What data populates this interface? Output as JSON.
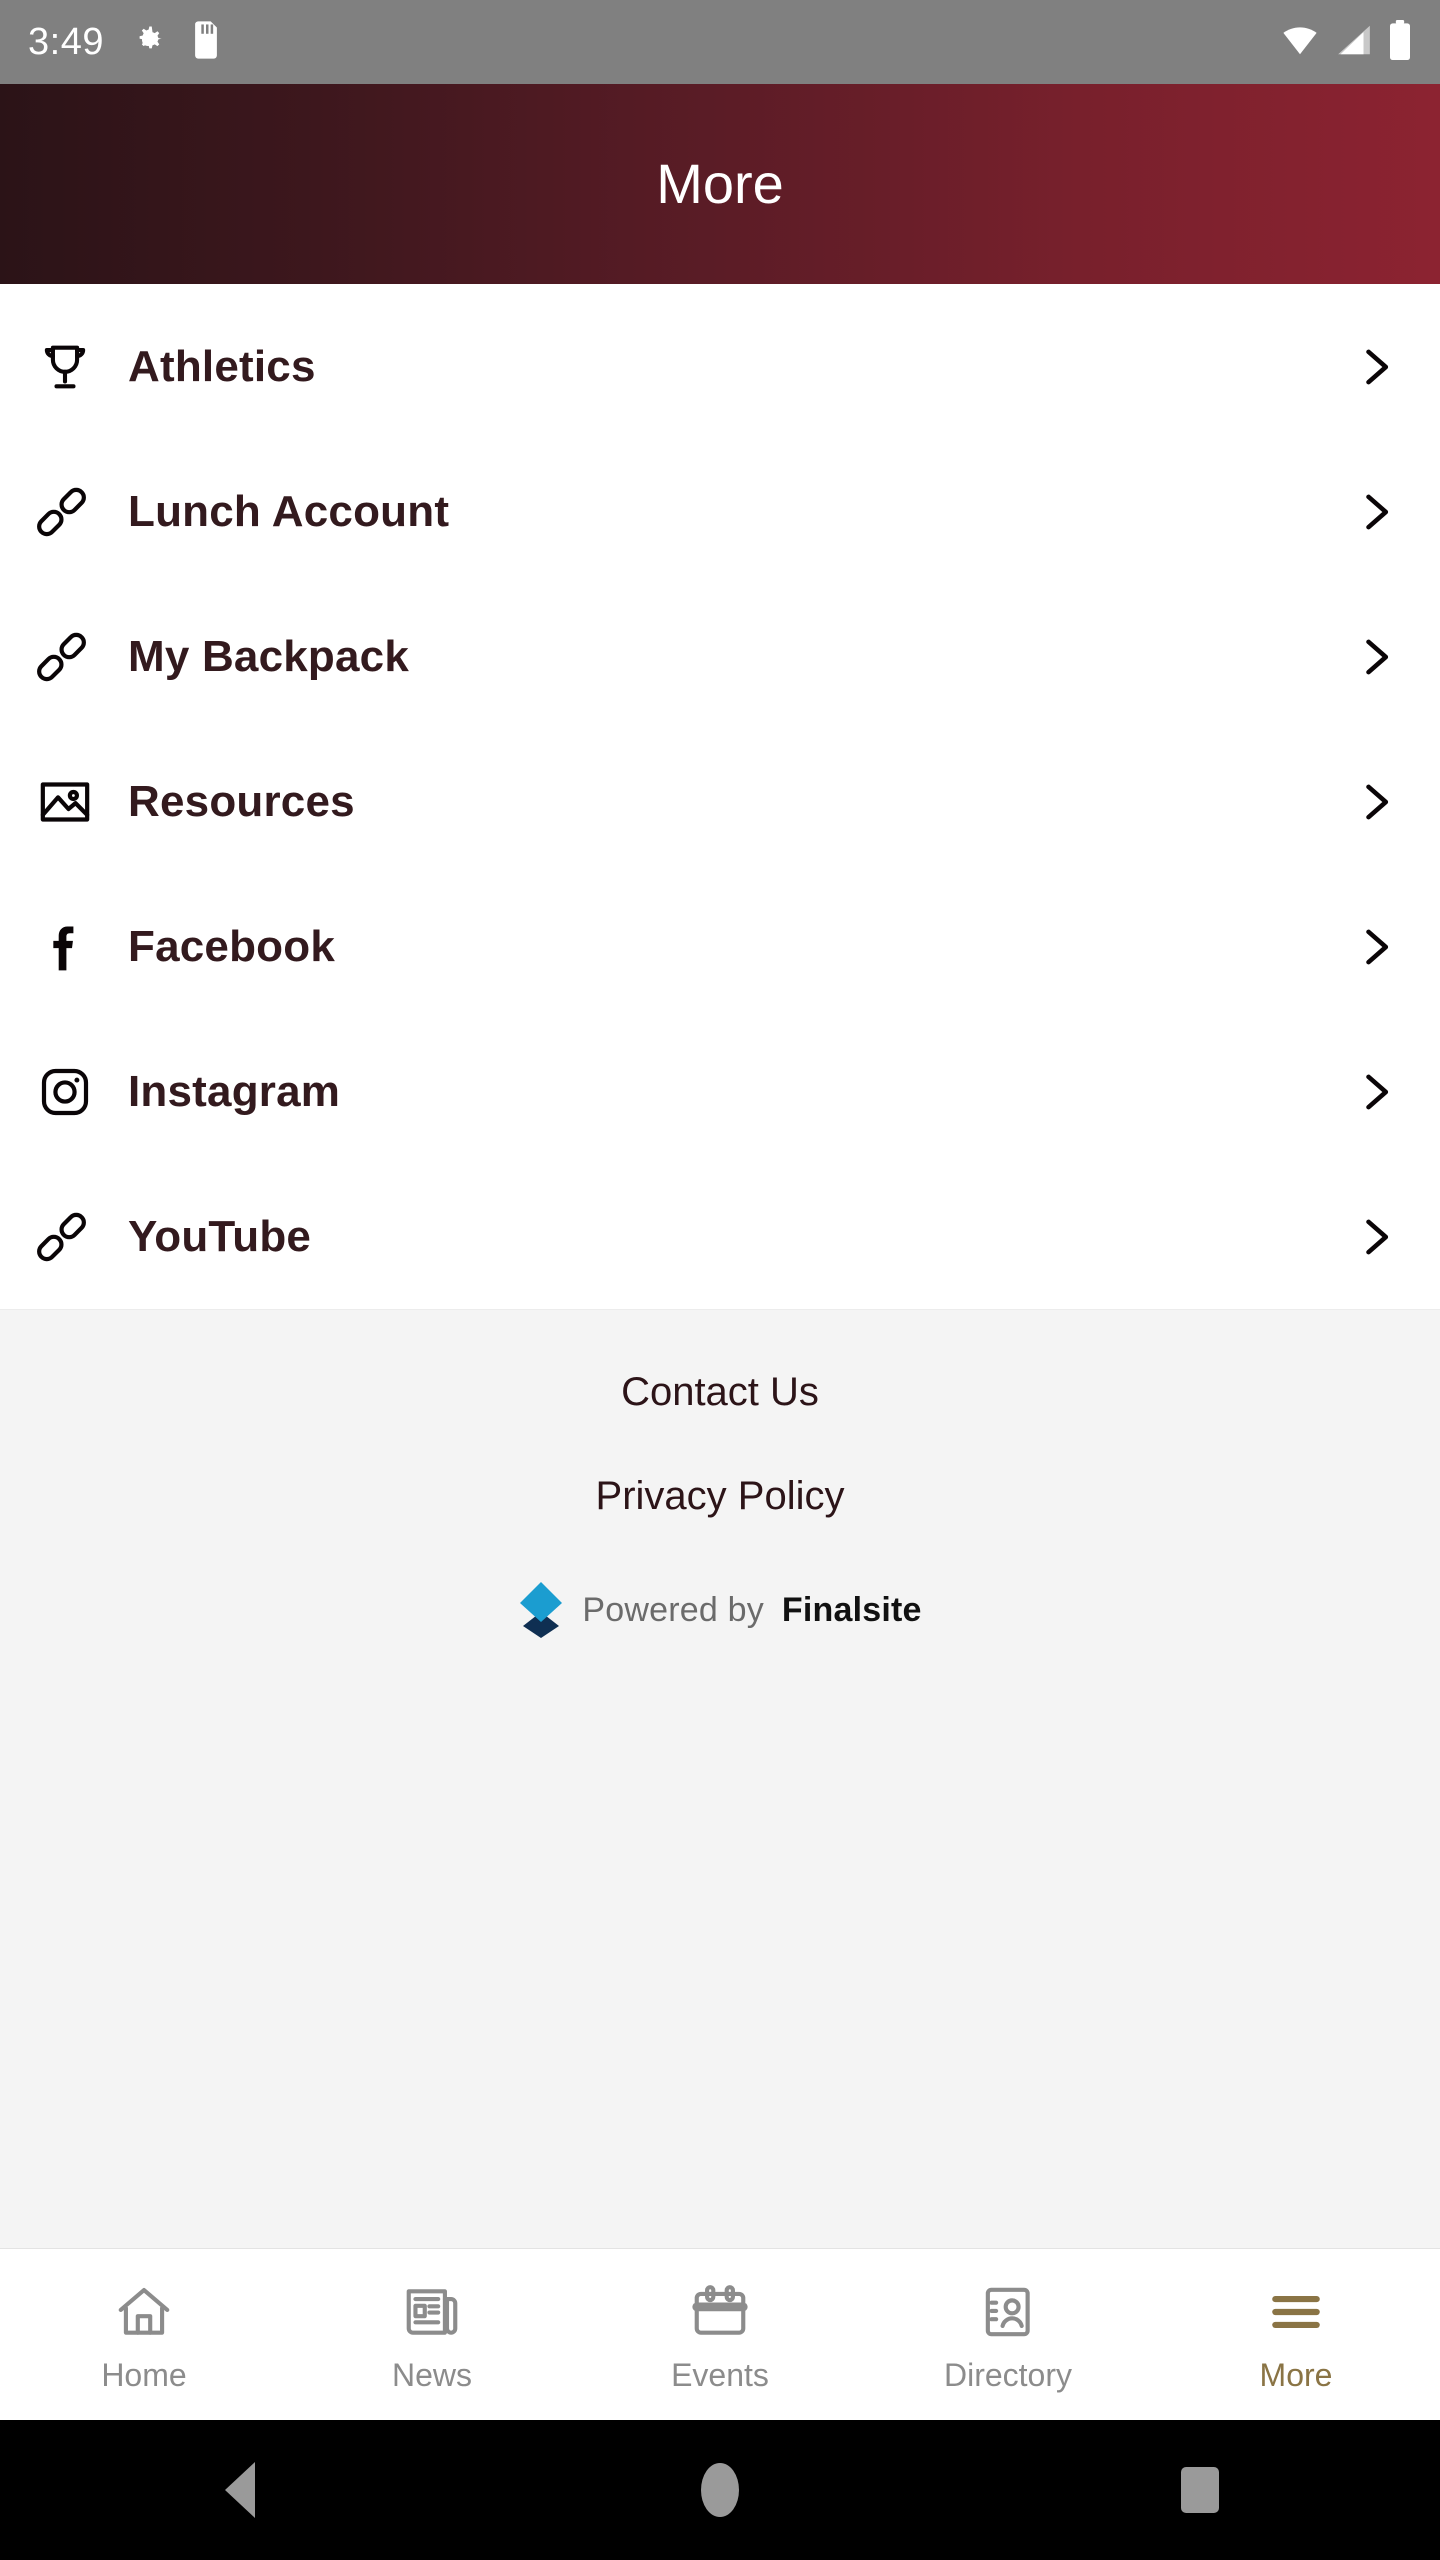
{
  "status_bar": {
    "time": "3:49",
    "left_icons": [
      "gear-icon",
      "sd-card-icon"
    ],
    "right_icons": [
      "wifi-icon",
      "cellular-signal-icon",
      "battery-icon"
    ],
    "background_color": "#808080"
  },
  "header": {
    "title": "More",
    "gradient_from": "#2b1317",
    "gradient_to": "#8c2331",
    "text_color": "#ffffff"
  },
  "menu": {
    "items": [
      {
        "label": "Athletics",
        "icon": "trophy-icon",
        "chevron": "chevron-right-icon"
      },
      {
        "label": "Lunch Account",
        "icon": "link-icon",
        "chevron": "chevron-right-icon"
      },
      {
        "label": "My Backpack",
        "icon": "link-icon",
        "chevron": "chevron-right-icon"
      },
      {
        "label": "Resources",
        "icon": "image-icon",
        "chevron": "chevron-right-icon"
      },
      {
        "label": "Facebook",
        "icon": "facebook-icon",
        "chevron": "chevron-right-icon"
      },
      {
        "label": "Instagram",
        "icon": "instagram-icon",
        "chevron": "chevron-right-icon"
      },
      {
        "label": "YouTube",
        "icon": "link-icon",
        "chevron": "chevron-right-icon"
      }
    ],
    "label_color": "#331a1e"
  },
  "footer": {
    "contact_label": "Contact Us",
    "privacy_label": "Privacy Policy",
    "powered_prefix": "Powered by",
    "powered_brand": "Finalsite",
    "logo_icon": "finalsite-diamond-logo",
    "logo_top_color": "#1b9dd0",
    "logo_bottom_color": "#0f2f52",
    "background_color": "#f4f4f4"
  },
  "tab_bar": {
    "active_color": "#8a7445",
    "inactive_color": "#8c8c8c",
    "tabs": [
      {
        "label": "Home",
        "icon": "home-icon",
        "active": false
      },
      {
        "label": "News",
        "icon": "newspaper-icon",
        "active": false
      },
      {
        "label": "Events",
        "icon": "calendar-icon",
        "active": false
      },
      {
        "label": "Directory",
        "icon": "contact-card-icon",
        "active": false
      },
      {
        "label": "More",
        "icon": "hamburger-menu-icon",
        "active": true
      }
    ]
  },
  "system_nav": {
    "back": "back-triangle-icon",
    "home": "home-circle-icon",
    "recents": "recents-square-icon"
  }
}
